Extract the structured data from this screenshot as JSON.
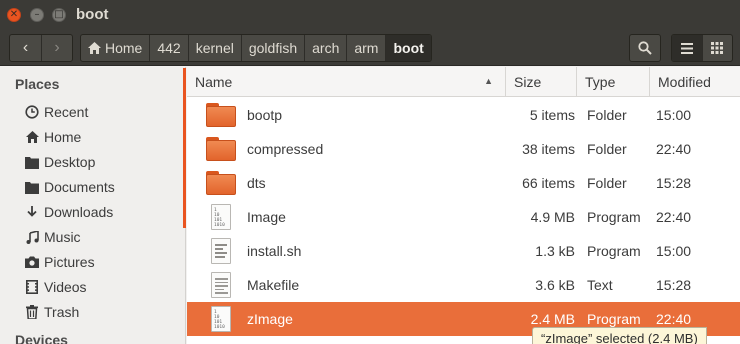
{
  "window": {
    "title": "boot"
  },
  "breadcrumbs": [
    "Home",
    "442",
    "kernel",
    "goldfish",
    "arch",
    "arm",
    "boot"
  ],
  "sidebar": {
    "sections": [
      {
        "title": "Places",
        "items": [
          {
            "label": "Recent",
            "icon": "clock-icon"
          },
          {
            "label": "Home",
            "icon": "home-icon"
          },
          {
            "label": "Desktop",
            "icon": "desktop-icon"
          },
          {
            "label": "Documents",
            "icon": "documents-icon"
          },
          {
            "label": "Downloads",
            "icon": "download-icon"
          },
          {
            "label": "Music",
            "icon": "music-icon"
          },
          {
            "label": "Pictures",
            "icon": "camera-icon"
          },
          {
            "label": "Videos",
            "icon": "film-icon"
          },
          {
            "label": "Trash",
            "icon": "trash-icon"
          }
        ]
      },
      {
        "title": "Devices",
        "items": []
      }
    ]
  },
  "columns": [
    "Name",
    "Size",
    "Type",
    "Modified"
  ],
  "files": [
    {
      "name": "bootp",
      "size": "5 items",
      "type": "Folder",
      "modified": "15:00",
      "kind": "folder"
    },
    {
      "name": "compressed",
      "size": "38 items",
      "type": "Folder",
      "modified": "22:40",
      "kind": "folder"
    },
    {
      "name": "dts",
      "size": "66 items",
      "type": "Folder",
      "modified": "15:28",
      "kind": "folder"
    },
    {
      "name": "Image",
      "size": "4.9 MB",
      "type": "Program",
      "modified": "22:40",
      "kind": "binary"
    },
    {
      "name": "install.sh",
      "size": "1.3 kB",
      "type": "Program",
      "modified": "15:00",
      "kind": "script"
    },
    {
      "name": "Makefile",
      "size": "3.6 kB",
      "type": "Text",
      "modified": "15:28",
      "kind": "text"
    },
    {
      "name": "zImage",
      "size": "2.4 MB",
      "type": "Program",
      "modified": "22:40",
      "kind": "binary",
      "selected": true
    }
  ],
  "binary_icon_text": [
    "1",
    "10",
    "101",
    "1010"
  ],
  "status": "“zImage” selected  (2.4 MB)",
  "colors": {
    "accent": "#e95420",
    "selection": "#e96e3a",
    "titlebar": "#3b3a36"
  }
}
